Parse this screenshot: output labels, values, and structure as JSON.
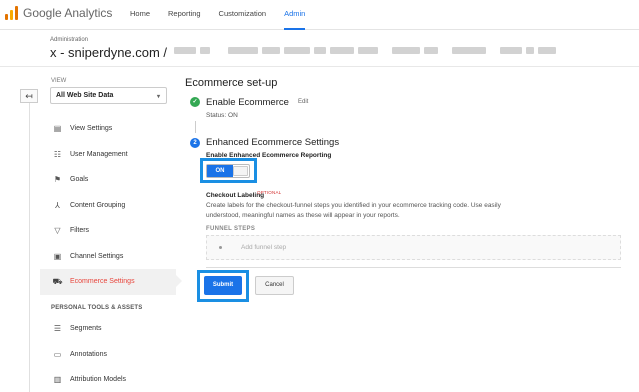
{
  "app": {
    "logo_google": "Google",
    "logo_product": "Analytics"
  },
  "nav": {
    "items": [
      "Home",
      "Reporting",
      "Customization",
      "Admin"
    ],
    "active": "Admin",
    "accent": "#1a73e8"
  },
  "header": {
    "breadcrumb": "Administration",
    "account": "x - sniperdyne.com /"
  },
  "view": {
    "label": "VIEW",
    "selected": "All Web Site Data"
  },
  "sidebar": {
    "items": [
      {
        "label": "View Settings",
        "icon": "document-icon"
      },
      {
        "label": "User Management",
        "icon": "users-icon"
      },
      {
        "label": "Goals",
        "icon": "flag-icon"
      },
      {
        "label": "Content Grouping",
        "icon": "person-icon"
      },
      {
        "label": "Filters",
        "icon": "filter-icon"
      },
      {
        "label": "Channel Settings",
        "icon": "channel-icon"
      },
      {
        "label": "Ecommerce Settings",
        "icon": "cart-icon",
        "active": true
      }
    ],
    "section_label": "PERSONAL TOOLS & ASSETS",
    "tools": [
      {
        "label": "Segments",
        "icon": "segments-icon"
      },
      {
        "label": "Annotations",
        "icon": "annotation-icon"
      },
      {
        "label": "Attribution Models",
        "icon": "bar-chart-icon"
      }
    ],
    "active_color": "#e8453c"
  },
  "main": {
    "title": "Ecommerce set-up",
    "step1": {
      "number": "✓",
      "title": "Enable Ecommerce",
      "edit": "Edit",
      "status": "Status: ON"
    },
    "step2": {
      "number": "2",
      "title": "Enhanced Ecommerce Settings",
      "sub_label": "Enable Enhanced Ecommerce Reporting",
      "toggle_label": "ON"
    },
    "checkout": {
      "label": "Checkout Labeling",
      "optional": "OPTIONAL",
      "description": "Create labels for the checkout-funnel steps you identified in your ecommerce tracking code. Use easily understood, meaningful names as these will appear in your reports."
    },
    "funnel": {
      "label": "FUNNEL STEPS",
      "add_placeholder": "Add funnel step"
    },
    "submit": "Submit",
    "cancel": "Cancel"
  }
}
